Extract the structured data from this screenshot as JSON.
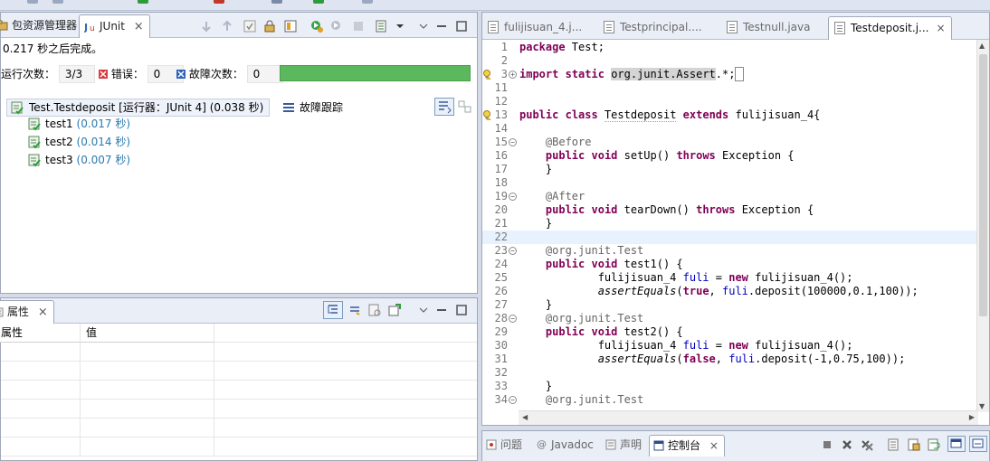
{
  "colors": {
    "progress_green": "#5cb85c",
    "keyword": "#7f0055",
    "annotation": "#646464",
    "time_text": "#2a7ab0"
  },
  "junit": {
    "tabs": [
      {
        "label": "包资源管理器",
        "icon": "package-explorer-icon"
      },
      {
        "label": "JUnit",
        "icon": "junit-icon",
        "close": "×"
      }
    ],
    "status": "0.217 秒之后完成。",
    "runs_label": "运行次数：",
    "runs_value": "3/3",
    "errors_label": "错误：",
    "errors_value": "0",
    "failures_label": "故障次数：",
    "failures_value": "0",
    "progress": 1.0,
    "suite": "Test.Testdeposit [运行器：JUnit 4] (0.038 秒)",
    "trace_title": "故障跟踪",
    "tests": [
      {
        "name": "test1",
        "time": "(0.017 秒)"
      },
      {
        "name": "test2",
        "time": "(0.014 秒)"
      },
      {
        "name": "test3",
        "time": "(0.007 秒)"
      }
    ]
  },
  "properties": {
    "tab_label": "属性",
    "tab_close": "×",
    "col_property": "属性",
    "col_value": "值"
  },
  "editor": {
    "tabs": [
      {
        "label": "fulijisuan_4.j...",
        "active": false
      },
      {
        "label": "Testprincipal....",
        "active": false
      },
      {
        "label": "Testnull.java",
        "active": false
      },
      {
        "label": "Testdeposit.j...",
        "active": true,
        "close": "×"
      }
    ],
    "lines": [
      {
        "n": "1",
        "text": "package Test;"
      },
      {
        "n": "2",
        "text": ""
      },
      {
        "n": "3",
        "text": "import static org.junit.Assert.*;"
      },
      {
        "n": "11",
        "text": ""
      },
      {
        "n": "12",
        "text": ""
      },
      {
        "n": "13",
        "text": "public class Testdeposit extends fulijisuan_4{"
      },
      {
        "n": "14",
        "text": ""
      },
      {
        "n": "15",
        "text": "    @Before"
      },
      {
        "n": "16",
        "text": "    public void setUp() throws Exception {"
      },
      {
        "n": "17",
        "text": "    }"
      },
      {
        "n": "18",
        "text": ""
      },
      {
        "n": "19",
        "text": "    @After"
      },
      {
        "n": "20",
        "text": "    public void tearDown() throws Exception {"
      },
      {
        "n": "21",
        "text": "    }"
      },
      {
        "n": "22",
        "text": ""
      },
      {
        "n": "23",
        "text": "    @org.junit.Test"
      },
      {
        "n": "24",
        "text": "    public void test1() {"
      },
      {
        "n": "25",
        "text": "            fulijisuan_4 fuli = new fulijisuan_4();"
      },
      {
        "n": "26",
        "text": "            assertEquals(true, fuli.deposit(100000,0.1,100));"
      },
      {
        "n": "27",
        "text": "    }"
      },
      {
        "n": "28",
        "text": "    @org.junit.Test"
      },
      {
        "n": "29",
        "text": "    public void test2() {"
      },
      {
        "n": "30",
        "text": "            fulijisuan_4 fuli = new fulijisuan_4();"
      },
      {
        "n": "31",
        "text": "            assertEquals(false, fuli.deposit(-1,0.75,100));"
      },
      {
        "n": "32",
        "text": ""
      },
      {
        "n": "33",
        "text": "    }"
      },
      {
        "n": "34",
        "text": "    @org.junit.Test"
      }
    ]
  },
  "console": {
    "tabs": [
      {
        "label": "问题",
        "active": false
      },
      {
        "label": "Javadoc",
        "active": false
      },
      {
        "label": "声明",
        "active": false
      },
      {
        "label": "控制台",
        "active": true,
        "close": "×"
      }
    ]
  }
}
